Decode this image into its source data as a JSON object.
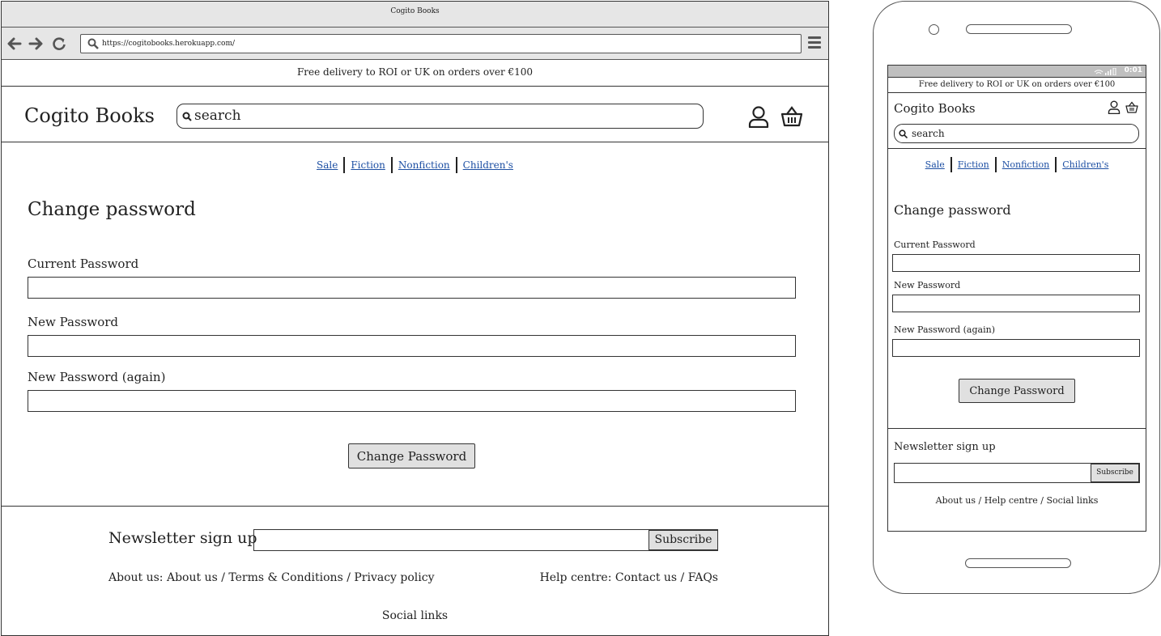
{
  "desktop": {
    "window_title": "Cogito Books",
    "url": "https://cogitobooks.herokuapp.com/",
    "delivery_banner": "Free delivery to ROI or UK on orders over €100",
    "logo": "Cogito Books",
    "search_placeholder": "search",
    "nav": [
      "Sale",
      "Fiction",
      "Nonfiction",
      "Children's"
    ],
    "page_title": "Change password",
    "fields": [
      "Current Password",
      "New Password",
      "New Password (again)"
    ],
    "submit_label": "Change Password",
    "footer": {
      "newsletter_title": "Newsletter sign up",
      "subscribe_label": "Subscribe",
      "about": "About us: About us / Terms & Conditions / Privacy policy",
      "help": "Help centre: Contact us / FAQs",
      "social": "Social links"
    }
  },
  "mobile": {
    "status_time": "0:01",
    "delivery_banner": "Free delivery to ROI or UK on orders over €100",
    "logo": "Cogito Books",
    "search_placeholder": "search",
    "nav": [
      "Sale",
      "Fiction",
      "Nonfiction",
      "Children's"
    ],
    "page_title": "Change password",
    "fields": [
      "Current Password",
      "New Password",
      "New Password (again)"
    ],
    "submit_label": "Change Password",
    "footer": {
      "newsletter_title": "Newsletter sign up",
      "subscribe_label": "Subscribe",
      "links": "About us / Help centre / Social links"
    }
  },
  "icons": [
    "back-arrow-icon",
    "forward-arrow-icon",
    "reload-icon",
    "search-icon",
    "menu-icon",
    "user-icon",
    "basket-icon"
  ],
  "colors": {
    "link": "#1d4fa3",
    "chrome": "#e6e6e6",
    "button": "#e0e0e0"
  }
}
